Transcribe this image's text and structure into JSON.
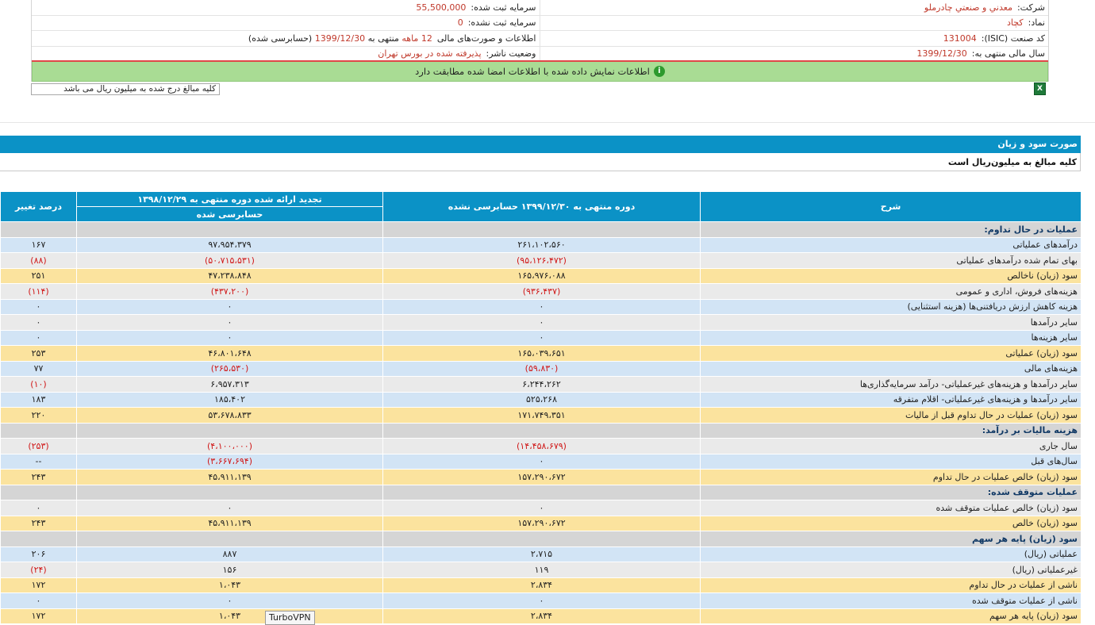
{
  "company_info": {
    "company_label": "شرکت:",
    "company_value": "معدني و صنعتي چادرملو",
    "registered_capital_label": "سرمایه ثبت شده:",
    "registered_capital_value": "55,500,000",
    "symbol_label": "نماد:",
    "symbol_value": "کچاد",
    "unregistered_capital_label": "سرمایه ثبت نشده:",
    "unregistered_capital_value": "0",
    "isic_label": "کد صنعت (ISIC):",
    "isic_value": "131004",
    "statements_label": "اطلاعات و صورت‌های مالی",
    "statements_months": "12 ماهه",
    "statements_ending": "منتهی به",
    "statements_date": "1399/12/30",
    "statements_status": "(حسابرسی شده)",
    "fiscal_year_label": "سال مالی منتهی به:",
    "fiscal_year_value": "1399/12/30",
    "publisher_status_label": "وضعیت ناشر:",
    "publisher_status_value": "پذیرفته شده در بورس تهران"
  },
  "notice": {
    "icon": "info-icon",
    "text": "اطلاعات نمایش داده شده با اطلاعات امضا شده مطابقت دارد"
  },
  "unit_note": "کلیه مبالغ درج شده به میلیون ریال می باشد",
  "excel_icon": "excel-export-icon",
  "section": {
    "title": "صورت سود و زیان",
    "unit": "کلیه مبالغ به میلیون‌ریال است"
  },
  "table": {
    "headers": {
      "desc": "شرح",
      "current": "دوره منتهی به ۱۳۹۹/۱۲/۳۰ حسابرسی نشده",
      "previous": "تجدید ارائه شده دوره منتهی به ۱۳۹۸/۱۲/۲۹",
      "previous_sub": "حسابرسی شده",
      "change": "درصد تغییر"
    },
    "rows": [
      {
        "type": "h",
        "desc": "عملیات در حال تداوم:",
        "cur": "",
        "prev": "",
        "chg": ""
      },
      {
        "type": "n",
        "desc": "درآمدهای عملیاتی",
        "cur": "۲۶۱،۱۰۲،۵۶۰",
        "prev": "۹۷،۹۵۴،۳۷۹",
        "chg": "۱۶۷"
      },
      {
        "type": "e",
        "desc": "بهای تمام شده درآمدهای عملیاتی",
        "cur": "(۹۵،۱۲۶،۴۷۲)",
        "prev": "(۵۰،۷۱۵،۵۳۱)",
        "chg": "(۸۸)"
      },
      {
        "type": "s",
        "desc": "سود (زیان) ناخالص",
        "cur": "۱۶۵،۹۷۶،۰۸۸",
        "prev": "۴۷،۲۳۸،۸۴۸",
        "chg": "۲۵۱"
      },
      {
        "type": "e",
        "desc": "هزینه‌های فروش، اداری و عمومی",
        "cur": "(۹۳۶،۴۳۷)",
        "prev": "(۴۳۷،۲۰۰)",
        "chg": "(۱۱۴)"
      },
      {
        "type": "n",
        "desc": "هزینه کاهش ارزش دریافتنی‌ها (هزینه استثنایی)",
        "cur": "۰",
        "prev": "۰",
        "chg": "۰"
      },
      {
        "type": "e",
        "desc": "سایر درآمدها",
        "cur": "۰",
        "prev": "۰",
        "chg": "۰"
      },
      {
        "type": "n",
        "desc": "سایر هزینه‌ها",
        "cur": "۰",
        "prev": "۰",
        "chg": "۰"
      },
      {
        "type": "s",
        "desc": "سود (زیان) عملیاتی",
        "cur": "۱۶۵،۰۳۹،۶۵۱",
        "prev": "۴۶،۸۰۱،۶۴۸",
        "chg": "۲۵۳"
      },
      {
        "type": "n",
        "desc": "هزینه‌های مالی",
        "cur": "(۵۹،۸۳۰)",
        "prev": "(۲۶۵،۵۳۰)",
        "chg": "۷۷"
      },
      {
        "type": "e",
        "desc": "سایر درآمدها و هزینه‌های غیرعملیاتی- درآمد سرمایه‌گذاری‌ها",
        "cur": "۶،۲۴۴،۲۶۲",
        "prev": "۶،۹۵۷،۳۱۳",
        "chg": "(۱۰)"
      },
      {
        "type": "n",
        "desc": "سایر درآمدها و هزینه‌های غیرعملیاتی- اقلام متفرقه",
        "cur": "۵۲۵،۲۶۸",
        "prev": "۱۸۵،۴۰۲",
        "chg": "۱۸۳"
      },
      {
        "type": "s",
        "desc": "سود (زیان) عملیات در حال تداوم قبل از مالیات",
        "cur": "۱۷۱،۷۴۹،۳۵۱",
        "prev": "۵۳،۶۷۸،۸۳۳",
        "chg": "۲۲۰"
      },
      {
        "type": "h",
        "desc": "هزینه مالیات بر درآمد:",
        "cur": "",
        "prev": "",
        "chg": ""
      },
      {
        "type": "e",
        "desc": "سال جاری",
        "cur": "(۱۴،۴۵۸،۶۷۹)",
        "prev": "(۴،۱۰۰،۰۰۰)",
        "chg": "(۲۵۳)"
      },
      {
        "type": "n",
        "desc": "سال‌های قبل",
        "cur": "۰",
        "prev": "(۳،۶۶۷،۶۹۴)",
        "chg": "--"
      },
      {
        "type": "s",
        "desc": "سود (زیان) خالص عملیات در حال تداوم",
        "cur": "۱۵۷،۲۹۰،۶۷۲",
        "prev": "۴۵،۹۱۱،۱۳۹",
        "chg": "۲۴۳"
      },
      {
        "type": "h",
        "desc": "عملیات متوقف شده:",
        "cur": "",
        "prev": "",
        "chg": ""
      },
      {
        "type": "e",
        "desc": "سود (زیان) خالص عملیات متوقف شده",
        "cur": "۰",
        "prev": "۰",
        "chg": "۰"
      },
      {
        "type": "s",
        "desc": "سود (زیان) خالص",
        "cur": "۱۵۷،۲۹۰،۶۷۲",
        "prev": "۴۵،۹۱۱،۱۳۹",
        "chg": "۲۴۳"
      },
      {
        "type": "h",
        "desc": "سود (زیان) پایه هر سهم",
        "cur": "",
        "prev": "",
        "chg": ""
      },
      {
        "type": "n",
        "desc": "عملیاتی (ریال)",
        "cur": "۲،۷۱۵",
        "prev": "۸۸۷",
        "chg": "۲۰۶"
      },
      {
        "type": "e",
        "desc": "غیرعملیاتی (ریال)",
        "cur": "۱۱۹",
        "prev": "۱۵۶",
        "chg": "(۲۴)"
      },
      {
        "type": "s",
        "desc": "ناشی از عملیات در حال تداوم",
        "cur": "۲،۸۳۴",
        "prev": "۱،۰۴۳",
        "chg": "۱۷۲"
      },
      {
        "type": "n",
        "desc": "ناشی از عملیات متوقف شده",
        "cur": "۰",
        "prev": "۰",
        "chg": "۰"
      },
      {
        "type": "s",
        "desc": "سود (زیان) پایه هر سهم",
        "cur": "۲،۸۳۴",
        "prev": "۱،۰۴۳",
        "chg": "۱۷۲"
      }
    ]
  },
  "tooltip": "TurboVPN"
}
